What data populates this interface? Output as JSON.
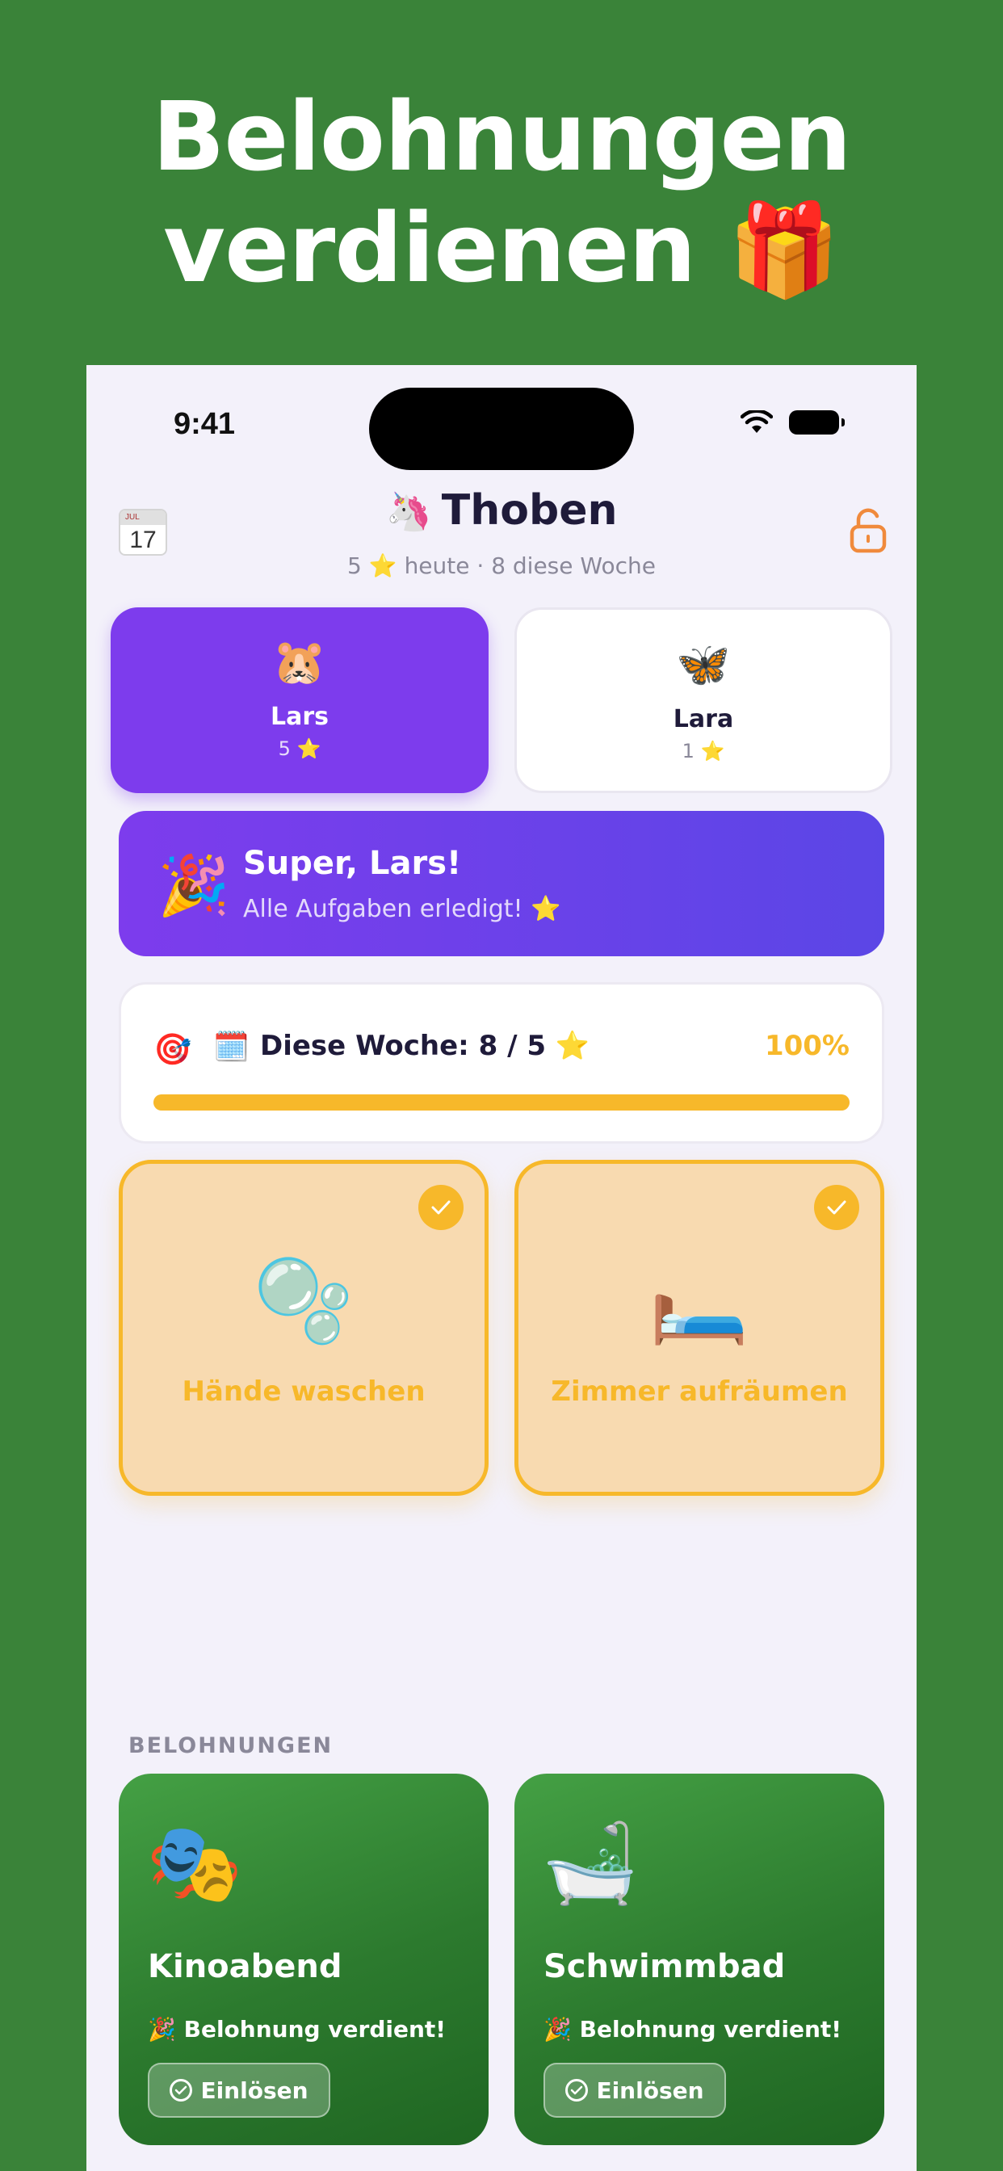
{
  "headline": {
    "line1": "Belohnungen",
    "line2": "verdienen",
    "gift_icon": "🎁"
  },
  "status_bar": {
    "time": "9:41"
  },
  "header": {
    "calendar_month": "JUL",
    "calendar_day": "17",
    "title_emoji": "🦄",
    "title": "Thoben",
    "stats_today": "5",
    "stats_star": "⭐",
    "stats_rest": "heute · 8 diese Woche"
  },
  "kids": [
    {
      "avatar": "🐹",
      "name": "Lars",
      "stars": "5",
      "star_icon": "⭐",
      "selected": true
    },
    {
      "avatar": "🦋",
      "name": "Lara",
      "stars": "1",
      "star_icon": "⭐",
      "selected": false
    }
  ],
  "banner": {
    "icon": "🎉",
    "title": "Super, Lars!",
    "subtitle": "Alle Aufgaben erledigt! ⭐"
  },
  "week": {
    "target_icon": "🎯",
    "calendar_icon": "🗓️",
    "label": "Diese Woche: 8 / 5 ⭐",
    "percent_text": "100%",
    "progress": 1.0
  },
  "tasks": [
    {
      "emoji": "🫧",
      "label": "Hände waschen",
      "done": true
    },
    {
      "emoji": "🛏️",
      "label": "Zimmer aufräumen",
      "done": true
    }
  ],
  "rewards_section": {
    "heading": "BELOHNUNGEN"
  },
  "rewards": [
    {
      "emoji": "🎭",
      "title": "Kinoabend",
      "earned": "🎉 Belohnung verdient!",
      "button": "Einlösen"
    },
    {
      "emoji": "🛁",
      "title": "Schwimmbad",
      "earned": "🎉 Belohnung verdient!",
      "button": "Einlösen"
    }
  ],
  "colors": {
    "background_green": "#3a8339",
    "purple": "#7d3ced",
    "indigo": "#5b46e6",
    "gold": "#f7b82a",
    "task_fill": "#f8dab0",
    "reward_green": "#2c7a2e"
  }
}
